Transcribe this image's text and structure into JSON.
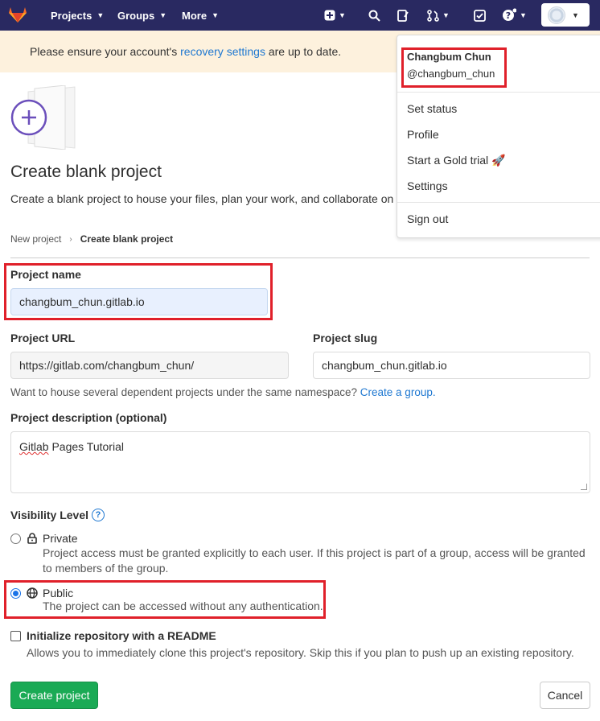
{
  "nav": {
    "projects": "Projects",
    "groups": "Groups",
    "more": "More",
    "icons": [
      "plus-square-icon",
      "search-icon",
      "issues-icon",
      "merge-request-icon",
      "todo-icon",
      "help-icon"
    ]
  },
  "banner": {
    "prefix": "Please ensure your account's ",
    "link": "recovery settings",
    "suffix": " are up to date."
  },
  "page": {
    "title": "Create blank project",
    "lead": "Create a blank project to house your files, plan your work, and collaborate on"
  },
  "breadcrumb": {
    "parent": "New project",
    "separator": "›",
    "current": "Create blank project"
  },
  "form": {
    "project_name_label": "Project name",
    "project_name_value": "changbum_chun.gitlab.io",
    "project_url_label": "Project URL",
    "project_url_value": "https://gitlab.com/changbum_chun/",
    "project_slug_label": "Project slug",
    "project_slug_value": "changbum_chun.gitlab.io",
    "namespace_help": "Want to house several dependent projects under the same namespace? ",
    "namespace_link": "Create a group.",
    "description_label": "Project description (optional)",
    "description_word1": "Gitlab",
    "description_rest": " Pages Tutorial",
    "visibility_label": "Visibility Level",
    "visibility_help": "?",
    "private_label": "Private",
    "private_desc": "Project access must be granted explicitly to each user. If this project is part of a group, access will be granted to members of the group.",
    "public_label": "Public",
    "public_desc": "The project can be accessed without any authentication.",
    "selected_visibility": "Public",
    "readme_label": "Initialize repository with a README",
    "readme_desc": "Allows you to immediately clone this project's repository. Skip this if you plan to push up an existing repository.",
    "readme_checked": false
  },
  "actions": {
    "create": "Create project",
    "cancel": "Cancel"
  },
  "user_menu": {
    "name": "Changbum Chun",
    "username": "@changbum_chun",
    "items": [
      "Set status",
      "Profile",
      "Start a Gold trial",
      "Settings",
      "Sign out"
    ],
    "gold_emoji": "🚀"
  },
  "colors": {
    "nav_bg": "#292961",
    "banner_bg": "#fdf1dd",
    "link": "#1f78d1",
    "primary_button": "#1aaa55",
    "highlight_box": "#e0202a"
  }
}
